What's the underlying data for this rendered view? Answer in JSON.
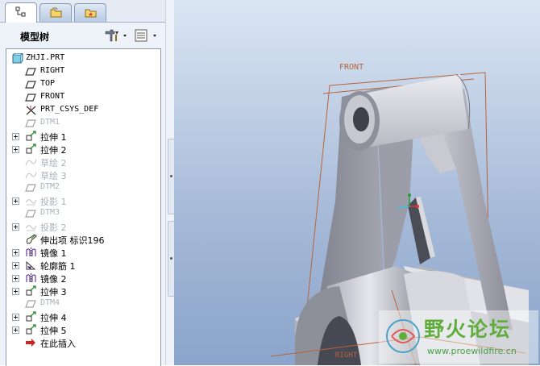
{
  "panel": {
    "title": "模型树",
    "tabs": [
      {
        "name": "model-tree-tab-icon",
        "active": true
      },
      {
        "name": "folder-browser-tab-icon",
        "active": false
      },
      {
        "name": "favorites-tab-icon",
        "active": false
      }
    ],
    "settings_icon": "tools-icon",
    "show_icon": "list-columns-icon"
  },
  "tree": {
    "items": [
      {
        "label": "ZHJI.PRT",
        "icon": "part-icon",
        "expandable": false,
        "dim": false,
        "mono": true
      },
      {
        "label": "RIGHT",
        "icon": "datum-plane-icon",
        "expandable": false,
        "dim": false,
        "mono": true
      },
      {
        "label": "TOP",
        "icon": "datum-plane-icon",
        "expandable": false,
        "dim": false,
        "mono": true
      },
      {
        "label": "FRONT",
        "icon": "datum-plane-icon",
        "expandable": false,
        "dim": false,
        "mono": true
      },
      {
        "label": "PRT_CSYS_DEF",
        "icon": "csys-icon",
        "expandable": false,
        "dim": false,
        "mono": true
      },
      {
        "label": "DTM1",
        "icon": "datum-plane-icon",
        "expandable": false,
        "dim": true,
        "mono": true
      },
      {
        "label": "拉伸 1",
        "icon": "extrude-icon",
        "expandable": true,
        "dim": false,
        "mono": false
      },
      {
        "label": "拉伸 2",
        "icon": "extrude-icon",
        "expandable": true,
        "dim": false,
        "mono": false
      },
      {
        "label": "草绘 2",
        "icon": "sketch-icon",
        "expandable": false,
        "dim": true,
        "mono": false
      },
      {
        "label": "草绘 3",
        "icon": "sketch-icon",
        "expandable": false,
        "dim": true,
        "mono": false
      },
      {
        "label": "DTM2",
        "icon": "datum-plane-icon",
        "expandable": false,
        "dim": true,
        "mono": true
      },
      {
        "label": "投影 1",
        "icon": "projection-icon",
        "expandable": true,
        "dim": true,
        "mono": false
      },
      {
        "label": "DTM3",
        "icon": "datum-plane-icon",
        "expandable": false,
        "dim": true,
        "mono": true
      },
      {
        "label": "投影 2",
        "icon": "projection-icon",
        "expandable": true,
        "dim": true,
        "mono": false
      },
      {
        "label": "伸出项 标识196",
        "icon": "protrusion-icon",
        "expandable": false,
        "dim": false,
        "mono": false
      },
      {
        "label": "镜像 1",
        "icon": "mirror-icon",
        "expandable": true,
        "dim": false,
        "mono": false
      },
      {
        "label": "轮廓筋 1",
        "icon": "rib-icon",
        "expandable": true,
        "dim": false,
        "mono": false
      },
      {
        "label": "镜像 2",
        "icon": "mirror-icon",
        "expandable": true,
        "dim": false,
        "mono": false
      },
      {
        "label": "拉伸 3",
        "icon": "extrude-icon",
        "expandable": true,
        "dim": false,
        "mono": false
      },
      {
        "label": "DTM4",
        "icon": "datum-plane-icon",
        "expandable": false,
        "dim": true,
        "mono": true
      },
      {
        "label": "拉伸 4",
        "icon": "extrude-icon",
        "expandable": true,
        "dim": false,
        "mono": false
      },
      {
        "label": "拉伸 5",
        "icon": "extrude-icon",
        "expandable": true,
        "dim": false,
        "mono": false
      },
      {
        "label": "在此插入",
        "icon": "insert-arrow-icon",
        "expandable": false,
        "dim": false,
        "mono": false
      }
    ]
  },
  "viewport": {
    "datum_label_front": "FRONT",
    "datum_label_right": "RIGHT"
  },
  "watermark": {
    "title": "野火论坛",
    "url": "www.proewildfire.cn"
  },
  "colors": {
    "panel_bg": "#eef3fa",
    "viewport_top": "#dbe6f4",
    "viewport_bottom": "#8aa4cb",
    "datum_line": "#b8643a",
    "model_gray": "#8c8c96"
  }
}
